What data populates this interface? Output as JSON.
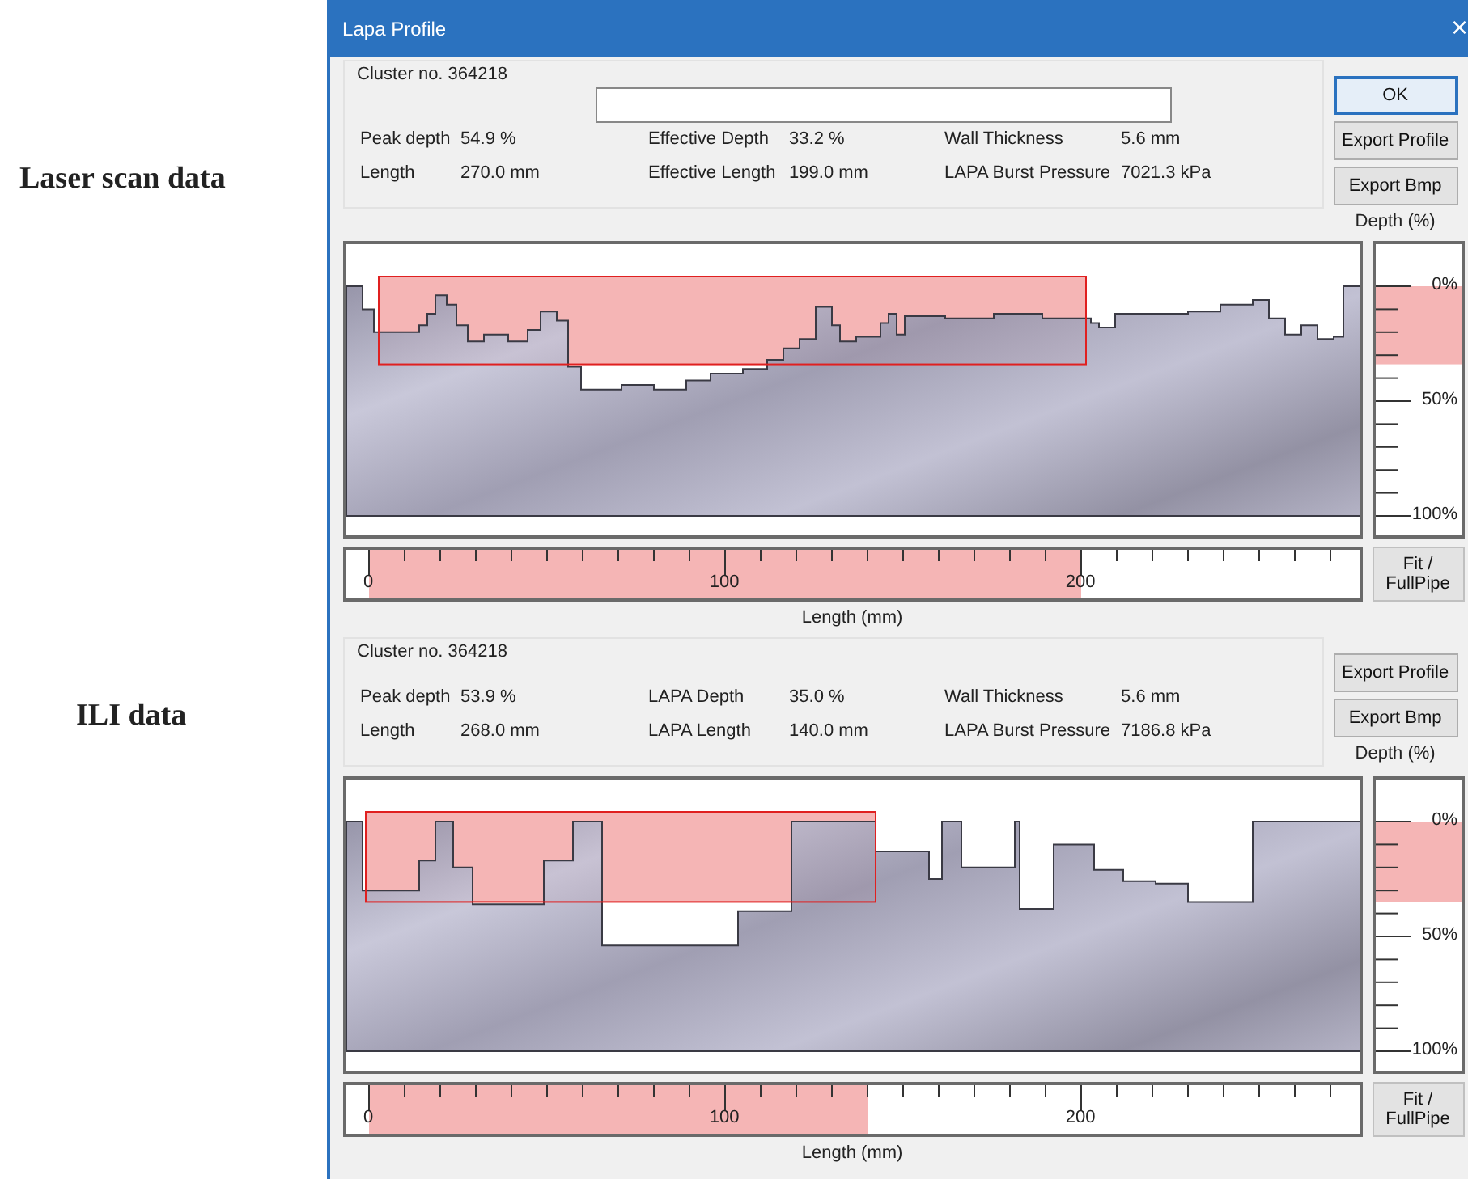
{
  "annotations": [
    "Laser scan data",
    "ILI data"
  ],
  "window": {
    "title": "Lapa Profile",
    "close": "×"
  },
  "panels": [
    {
      "cluster": "Cluster no. 364218",
      "name_field": {
        "kind": "text"
      },
      "fields": [
        {
          "label": "Peak depth",
          "value": "54.9 %"
        },
        {
          "label": "Effective Depth",
          "value": "33.2 %"
        },
        {
          "label": "Wall Thickness",
          "value": "5.6 mm"
        },
        {
          "label": "Length",
          "value": "270.0 mm"
        },
        {
          "label": "Effective Length",
          "value": "199.0 mm"
        },
        {
          "label": "LAPA Burst Pressure",
          "value": "7021.3 kPa"
        }
      ],
      "buttons": [
        {
          "label": "OK",
          "default": true
        },
        {
          "label": "Export Profile",
          "default": false
        },
        {
          "label": "Export Bmp",
          "default": false
        }
      ],
      "depth_label": "Depth (%)",
      "depth_ticks": [
        "0%",
        "50%",
        "100%"
      ],
      "ruler_labels": [
        "0",
        "100",
        "200"
      ],
      "fit_button": "Fit /\nFullPipe",
      "axis_label": "Length (mm)"
    },
    {
      "cluster": "Cluster no. 364218",
      "fields": [
        {
          "label": "Peak depth",
          "value": "53.9 %"
        },
        {
          "label": "LAPA Depth",
          "value": "35.0 %"
        },
        {
          "label": "Wall Thickness",
          "value": "5.6 mm"
        },
        {
          "label": "Length",
          "value": "268.0 mm"
        },
        {
          "label": "LAPA Length",
          "value": "140.0 mm"
        },
        {
          "label": "LAPA Burst Pressure",
          "value": "7186.8 kPa"
        }
      ],
      "buttons": [
        {
          "label": "Export Profile",
          "default": false
        },
        {
          "label": "Export Bmp",
          "default": false
        }
      ],
      "depth_label": "Depth (%)",
      "depth_ticks": [
        "0%",
        "50%",
        "100%"
      ],
      "ruler_labels": [
        "0",
        "100",
        "200"
      ],
      "fit_button": "Fit /\nFullPipe",
      "axis_label": "Length (mm)"
    }
  ]
}
